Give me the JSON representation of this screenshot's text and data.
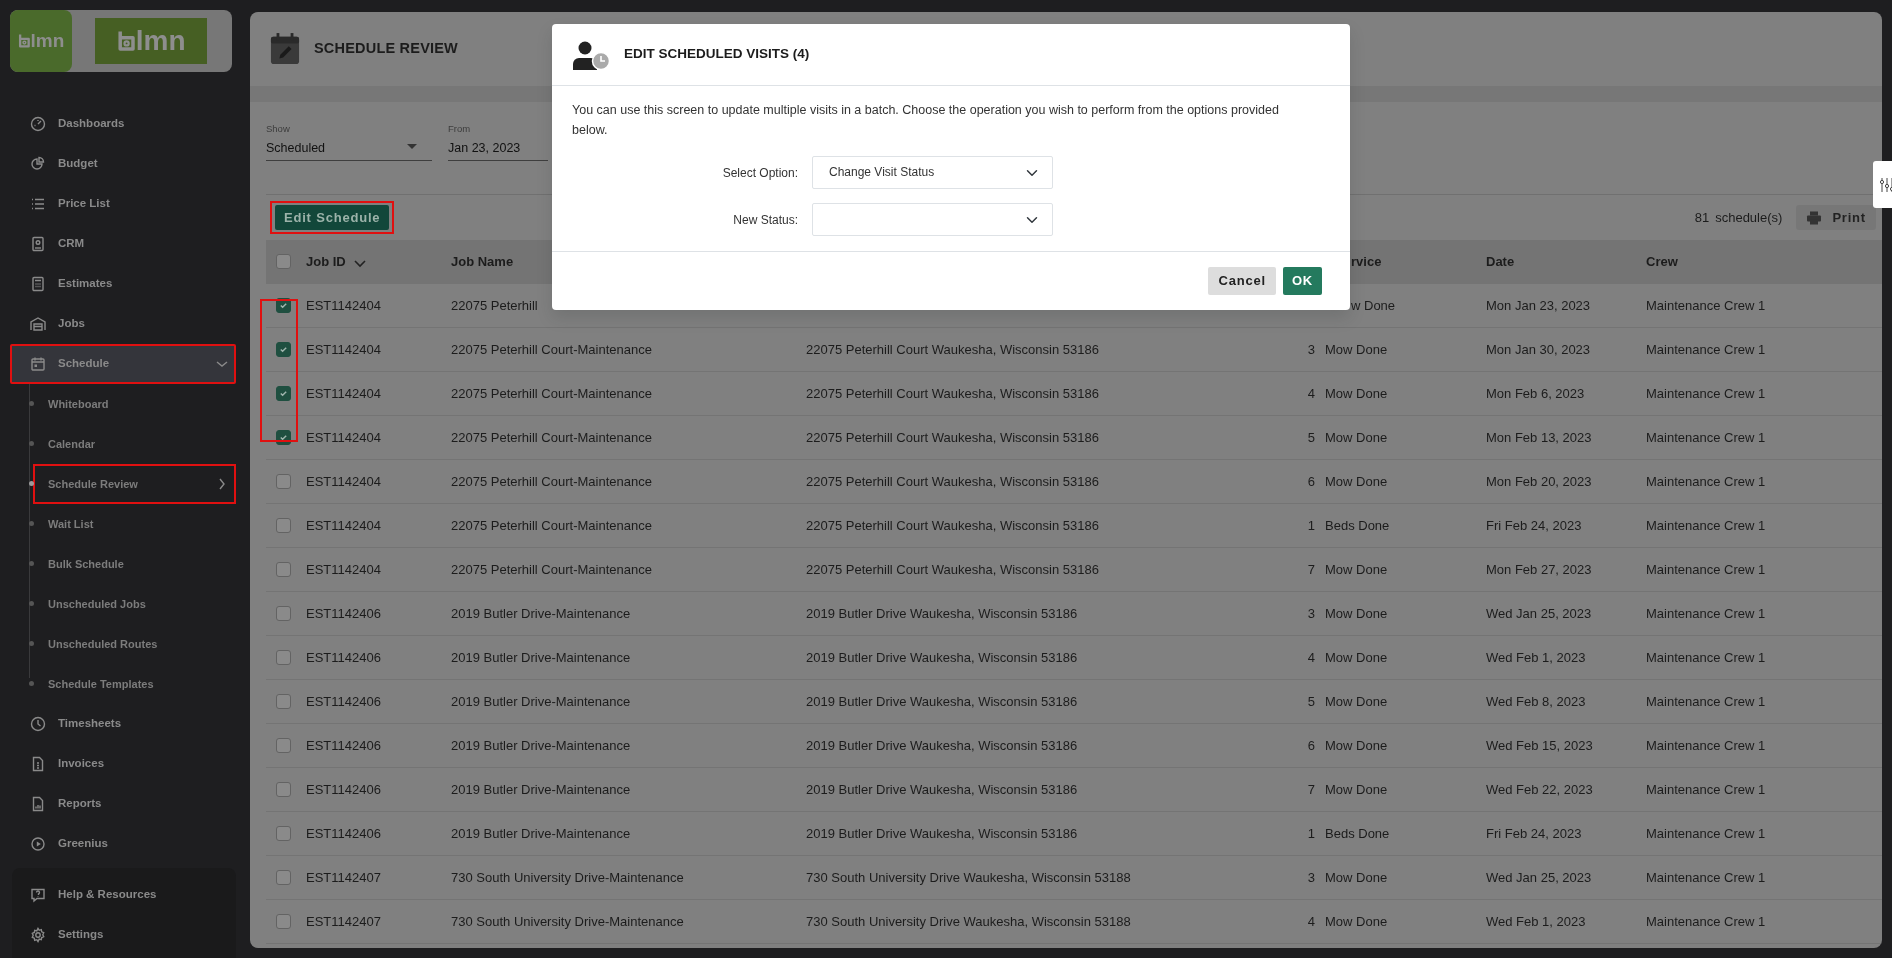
{
  "logo": {
    "mark_text": "lmn",
    "wide_text": "lmn"
  },
  "sidebar": {
    "items": [
      {
        "label": "Dashboards",
        "selected": false,
        "highlighted": false
      },
      {
        "label": "Budget",
        "selected": false,
        "highlighted": false
      },
      {
        "label": "Price List",
        "selected": false,
        "highlighted": false
      },
      {
        "label": "CRM",
        "selected": false,
        "highlighted": false
      },
      {
        "label": "Estimates",
        "selected": false,
        "highlighted": false
      },
      {
        "label": "Jobs",
        "selected": false,
        "highlighted": false
      },
      {
        "label": "Schedule",
        "selected": true,
        "highlighted": true,
        "expanded": true,
        "children": [
          {
            "label": "Whiteboard",
            "selected": false,
            "highlighted": false
          },
          {
            "label": "Calendar",
            "selected": false,
            "highlighted": false
          },
          {
            "label": "Schedule Review",
            "selected": true,
            "highlighted": true
          },
          {
            "label": "Wait List",
            "selected": false,
            "highlighted": false
          },
          {
            "label": "Bulk Schedule",
            "selected": false,
            "highlighted": false
          },
          {
            "label": "Unscheduled Jobs",
            "selected": false,
            "highlighted": false
          },
          {
            "label": "Unscheduled Routes",
            "selected": false,
            "highlighted": false
          },
          {
            "label": "Schedule Templates",
            "selected": false,
            "highlighted": false
          }
        ]
      },
      {
        "label": "Timesheets",
        "selected": false,
        "highlighted": false
      },
      {
        "label": "Invoices",
        "selected": false,
        "highlighted": false
      },
      {
        "label": "Reports",
        "selected": false,
        "highlighted": false
      },
      {
        "label": "Greenius",
        "selected": false,
        "highlighted": false
      }
    ],
    "footer_items": [
      {
        "label": "Help & Resources"
      },
      {
        "label": "Settings"
      }
    ]
  },
  "page": {
    "title": "SCHEDULE REVIEW"
  },
  "filters": [
    {
      "kind": "dropdown",
      "label": "Show",
      "value": "Scheduled"
    },
    {
      "kind": "date",
      "label": "From",
      "value": "Jan 23, 2023"
    }
  ],
  "toolbar": {
    "edit_button": {
      "label": "Edit Schedule",
      "highlighted": true
    },
    "count": "81",
    "count_label": "schedule(s)",
    "print_button": "Print"
  },
  "table": {
    "select_all_checked": false,
    "columns": [
      {
        "label": "Job ID",
        "sorted": true
      },
      {
        "label": "Job Name",
        "sorted": false
      },
      null,
      null,
      {
        "label": "rvice",
        "sorted": false
      },
      {
        "label": "Date",
        "sorted": false
      },
      {
        "label": "Crew",
        "sorted": false
      }
    ],
    "rows": [
      {
        "checked": true,
        "highlighted": true,
        "cells": [
          "EST1142404",
          "22075 Peterhill",
          null,
          null,
          "w Done",
          "Mon Jan 23, 2023",
          "Maintenance Crew 1"
        ]
      },
      {
        "checked": true,
        "highlighted": true,
        "cells": [
          "EST1142404",
          "22075 Peterhill Court-Maintenance",
          "22075 Peterhill Court Waukesha, Wisconsin 53186",
          "3",
          "Mow Done",
          "Mon Jan 30, 2023",
          "Maintenance Crew 1"
        ]
      },
      {
        "checked": true,
        "highlighted": true,
        "cells": [
          "EST1142404",
          "22075 Peterhill Court-Maintenance",
          "22075 Peterhill Court Waukesha, Wisconsin 53186",
          "4",
          "Mow Done",
          "Mon Feb 6, 2023",
          "Maintenance Crew 1"
        ]
      },
      {
        "checked": true,
        "highlighted": true,
        "cells": [
          "EST1142404",
          "22075 Peterhill Court-Maintenance",
          "22075 Peterhill Court Waukesha, Wisconsin 53186",
          "5",
          "Mow Done",
          "Mon Feb 13, 2023",
          "Maintenance Crew 1"
        ]
      },
      {
        "checked": false,
        "highlighted": false,
        "cells": [
          "EST1142404",
          "22075 Peterhill Court-Maintenance",
          "22075 Peterhill Court Waukesha, Wisconsin 53186",
          "6",
          "Mow Done",
          "Mon Feb 20, 2023",
          "Maintenance Crew 1"
        ]
      },
      {
        "checked": false,
        "highlighted": false,
        "cells": [
          "EST1142404",
          "22075 Peterhill Court-Maintenance",
          "22075 Peterhill Court Waukesha, Wisconsin 53186",
          "1",
          "Beds Done",
          "Fri Feb 24, 2023",
          "Maintenance Crew 1"
        ]
      },
      {
        "checked": false,
        "highlighted": false,
        "cells": [
          "EST1142404",
          "22075 Peterhill Court-Maintenance",
          "22075 Peterhill Court Waukesha, Wisconsin 53186",
          "7",
          "Mow Done",
          "Mon Feb 27, 2023",
          "Maintenance Crew 1"
        ]
      },
      {
        "checked": false,
        "highlighted": false,
        "cells": [
          "EST1142406",
          "2019 Butler Drive-Maintenance",
          "2019 Butler Drive Waukesha, Wisconsin 53186",
          "3",
          "Mow Done",
          "Wed Jan 25, 2023",
          "Maintenance Crew 1"
        ]
      },
      {
        "checked": false,
        "highlighted": false,
        "cells": [
          "EST1142406",
          "2019 Butler Drive-Maintenance",
          "2019 Butler Drive Waukesha, Wisconsin 53186",
          "4",
          "Mow Done",
          "Wed Feb 1, 2023",
          "Maintenance Crew 1"
        ]
      },
      {
        "checked": false,
        "highlighted": false,
        "cells": [
          "EST1142406",
          "2019 Butler Drive-Maintenance",
          "2019 Butler Drive Waukesha, Wisconsin 53186",
          "5",
          "Mow Done",
          "Wed Feb 8, 2023",
          "Maintenance Crew 1"
        ]
      },
      {
        "checked": false,
        "highlighted": false,
        "cells": [
          "EST1142406",
          "2019 Butler Drive-Maintenance",
          "2019 Butler Drive Waukesha, Wisconsin 53186",
          "6",
          "Mow Done",
          "Wed Feb 15, 2023",
          "Maintenance Crew 1"
        ]
      },
      {
        "checked": false,
        "highlighted": false,
        "cells": [
          "EST1142406",
          "2019 Butler Drive-Maintenance",
          "2019 Butler Drive Waukesha, Wisconsin 53186",
          "7",
          "Mow Done",
          "Wed Feb 22, 2023",
          "Maintenance Crew 1"
        ]
      },
      {
        "checked": false,
        "highlighted": false,
        "cells": [
          "EST1142406",
          "2019 Butler Drive-Maintenance",
          "2019 Butler Drive Waukesha, Wisconsin 53186",
          "1",
          "Beds Done",
          "Fri Feb 24, 2023",
          "Maintenance Crew 1"
        ]
      },
      {
        "checked": false,
        "highlighted": false,
        "cells": [
          "EST1142407",
          "730 South University Drive-Maintenance",
          "730 South University Drive Waukesha, Wisconsin 53188",
          "3",
          "Mow Done",
          "Wed Jan 25, 2023",
          "Maintenance Crew 1"
        ]
      },
      {
        "checked": false,
        "highlighted": false,
        "cells": [
          "EST1142407",
          "730 South University Drive-Maintenance",
          "730 South University Drive Waukesha, Wisconsin 53188",
          "4",
          "Mow Done",
          "Wed Feb 1, 2023",
          "Maintenance Crew 1"
        ]
      }
    ]
  },
  "modal": {
    "title": "EDIT SCHEDULED VISITS (4)",
    "description": "You can use this screen to update multiple visits in a batch. Choose the operation you wish to perform from the options provided below.",
    "fields": [
      {
        "label": "Select Option:",
        "value": "Change Visit Status"
      },
      {
        "label": "New Status:"
      }
    ],
    "buttons": [
      {
        "kind": "secondary",
        "label": "Cancel"
      },
      {
        "kind": "primary",
        "label": "OK"
      }
    ]
  }
}
